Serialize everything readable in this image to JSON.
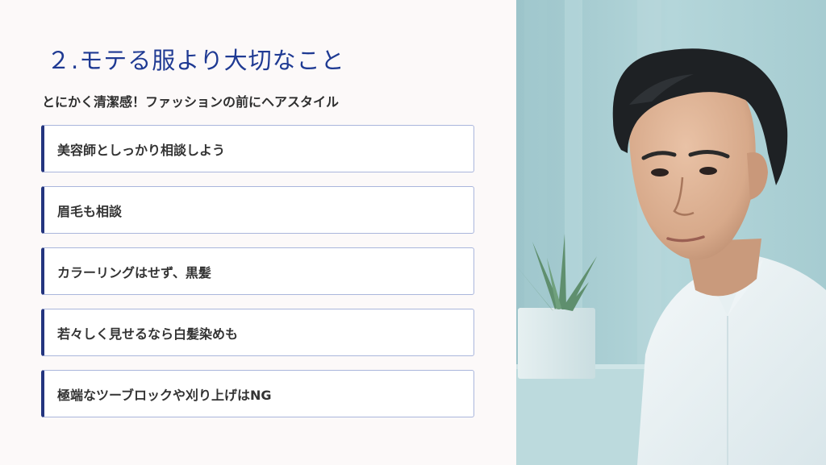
{
  "title": "２.モテる服より大切なこと",
  "subtitle": "とにかく清潔感！ファッションの前にヘアスタイル",
  "items": [
    {
      "label": "美容師としっかり相談しよう"
    },
    {
      "label": "眉毛も相談"
    },
    {
      "label": "カラーリングはせず、黒髪"
    },
    {
      "label": "若々しく見せるなら白髪染めも"
    },
    {
      "label": "極端なツーブロックや刈り上げはNG"
    }
  ],
  "colors": {
    "title": "#1f3a93",
    "accent_bar": "#24357f",
    "card_border": "#aab6dc",
    "background": "#fcf9f9"
  }
}
